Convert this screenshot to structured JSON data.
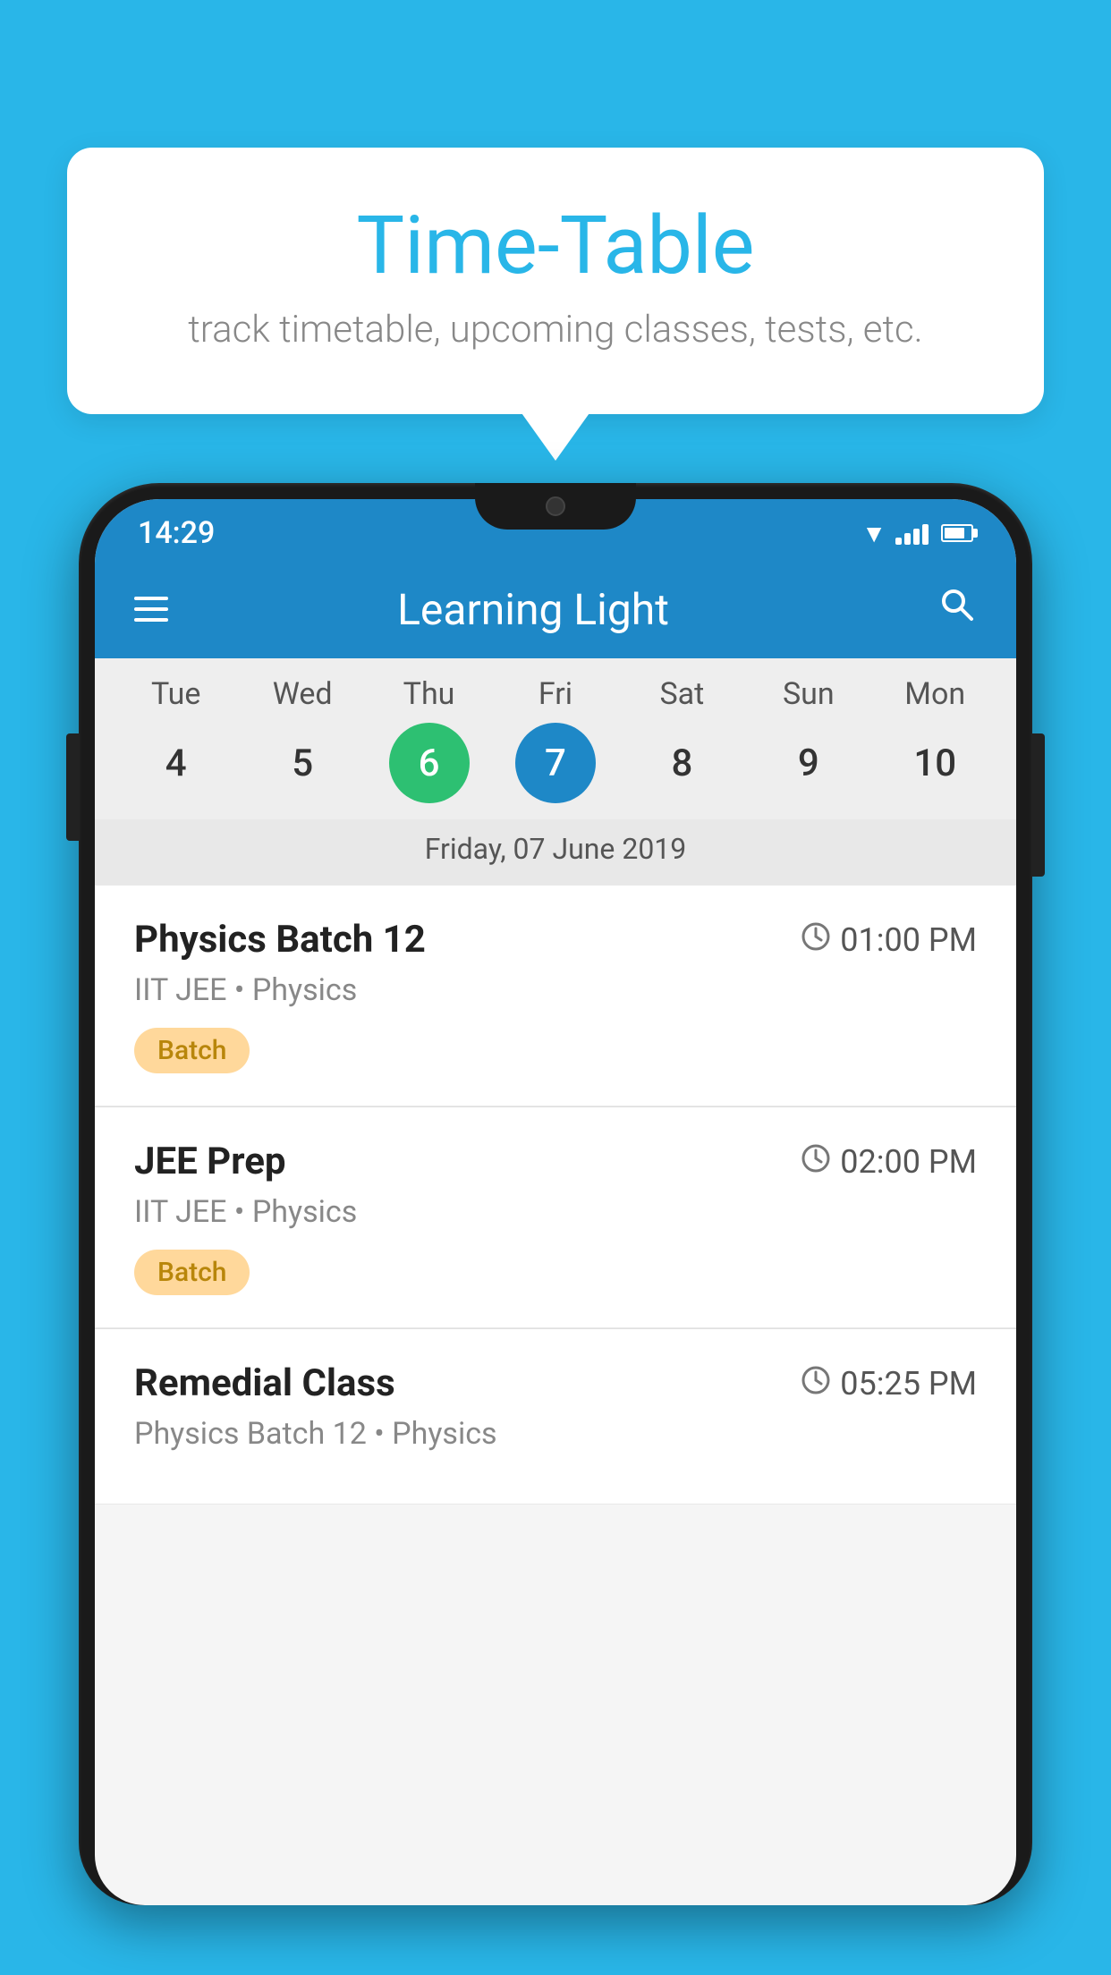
{
  "background": {
    "color": "#29b6e8"
  },
  "speech_bubble": {
    "title": "Time-Table",
    "subtitle": "track timetable, upcoming classes, tests, etc."
  },
  "status_bar": {
    "time": "14:29"
  },
  "app_bar": {
    "title": "Learning Light",
    "menu_icon": "☰",
    "search_icon": "🔍"
  },
  "calendar": {
    "selected_date_label": "Friday, 07 June 2019",
    "days": [
      {
        "short": "Tue",
        "num": "4",
        "state": "normal"
      },
      {
        "short": "Wed",
        "num": "5",
        "state": "normal"
      },
      {
        "short": "Thu",
        "num": "6",
        "state": "today"
      },
      {
        "short": "Fri",
        "num": "7",
        "state": "selected"
      },
      {
        "short": "Sat",
        "num": "8",
        "state": "normal"
      },
      {
        "short": "Sun",
        "num": "9",
        "state": "normal"
      },
      {
        "short": "Mon",
        "num": "10",
        "state": "normal"
      }
    ]
  },
  "schedule": {
    "items": [
      {
        "title": "Physics Batch 12",
        "time": "01:00 PM",
        "subtitle": "IIT JEE • Physics",
        "badge": "Batch"
      },
      {
        "title": "JEE Prep",
        "time": "02:00 PM",
        "subtitle": "IIT JEE • Physics",
        "badge": "Batch"
      },
      {
        "title": "Remedial Class",
        "time": "05:25 PM",
        "subtitle": "Physics Batch 12 • Physics",
        "badge": null
      }
    ]
  }
}
